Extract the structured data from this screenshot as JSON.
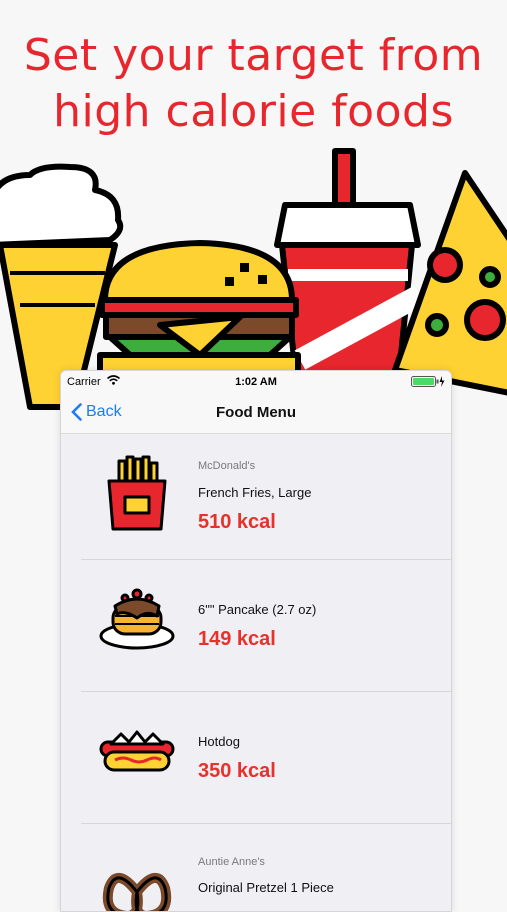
{
  "headline": {
    "line1": "Set your target from",
    "line2": "high calorie foods"
  },
  "status": {
    "carrier": "Carrier",
    "time": "1:02 AM"
  },
  "nav": {
    "back_label": "Back",
    "title": "Food Menu"
  },
  "items": [
    {
      "brand": "McDonald's",
      "name": "French Fries, Large",
      "kcal": "510 kcal",
      "icon": "french-fries-icon"
    },
    {
      "brand": "",
      "name": "6\"\" Pancake (2.7 oz)",
      "kcal": "149 kcal",
      "icon": "pancake-icon"
    },
    {
      "brand": "",
      "name": "Hotdog",
      "kcal": "350 kcal",
      "icon": "hotdog-icon"
    },
    {
      "brand": "Auntie Anne's",
      "name": "Original Pretzel 1 Piece",
      "kcal": "",
      "icon": "pretzel-icon"
    }
  ],
  "colors": {
    "headline": "#e8262d",
    "kcal": "#e8312a",
    "link": "#1a7cf5"
  }
}
